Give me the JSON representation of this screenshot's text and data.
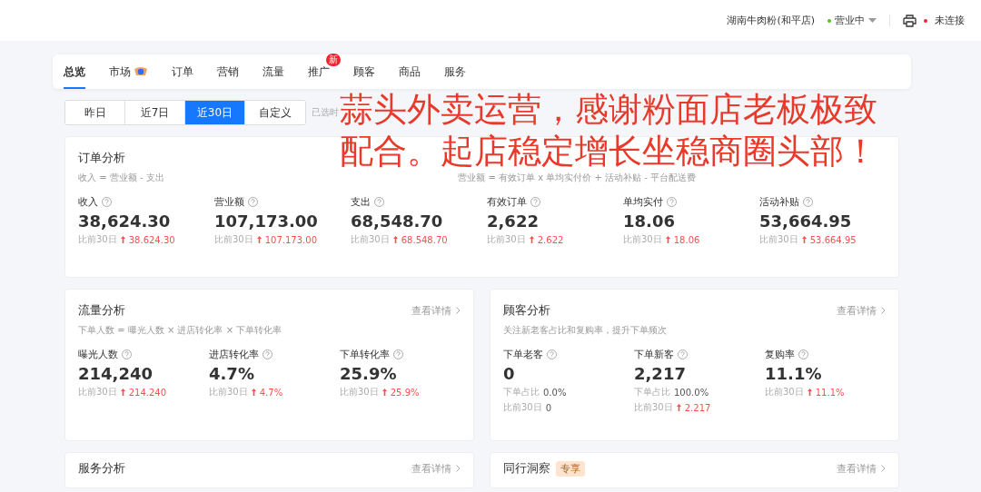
{
  "header": {
    "store": "湖南牛肉粉(和平店)",
    "status": "营业中",
    "printer": "未连接"
  },
  "tabs": [
    {
      "label": "总览",
      "selected": true
    },
    {
      "label": "市场",
      "selected": false,
      "icon": true
    },
    {
      "label": "订单",
      "selected": false
    },
    {
      "label": "营销",
      "selected": false
    },
    {
      "label": "流量",
      "selected": false
    },
    {
      "label": "推广",
      "selected": false,
      "badge": "新"
    },
    {
      "label": "顾客",
      "selected": false
    },
    {
      "label": "商品",
      "selected": false
    },
    {
      "label": "服务",
      "selected": false
    }
  ],
  "ranges": [
    {
      "label": "昨日",
      "selected": false
    },
    {
      "label": "近7日",
      "selected": false
    },
    {
      "label": "近30日",
      "selected": true
    },
    {
      "label": "自定义",
      "selected": false
    }
  ],
  "range_note": "已选时",
  "order_card": {
    "title": "订单分析",
    "formulas": [
      "收入 = 营业额 - 支出",
      "营业额 = 有效订单 x 单均实付价 + 活动补贴 - 平台配送费"
    ],
    "metrics": [
      {
        "label": "收入",
        "value": "38,624.30",
        "compare": "比前30日",
        "change": "38.624.30"
      },
      {
        "label": "营业额",
        "value": "107,173.00",
        "compare": "比前30日",
        "change": "107.173.00"
      },
      {
        "label": "支出",
        "value": "68,548.70",
        "compare": "比前30日",
        "change": "68.548.70"
      },
      {
        "label": "有效订单",
        "value": "2,622",
        "compare": "比前30日",
        "change": "2.622"
      },
      {
        "label": "单均实付",
        "value": "18.06",
        "compare": "比前30日",
        "change": "18.06"
      },
      {
        "label": "活动补贴",
        "value": "53,664.95",
        "compare": "比前30日",
        "change": "53.664.95"
      }
    ]
  },
  "cards": [
    {
      "title": "流量分析",
      "link": "查看详情",
      "formula": "下单人数 = 曝光人数 × 进店转化率 × 下单转化率",
      "metrics": [
        {
          "label": "曝光人数",
          "value": "214,240",
          "lines": [
            {
              "label": "比前30日",
              "value": "214.240",
              "up": true
            }
          ]
        },
        {
          "label": "进店转化率",
          "value": "4.7%",
          "lines": [
            {
              "label": "比前30日",
              "value": "4.7%",
              "up": true
            }
          ]
        },
        {
          "label": "下单转化率",
          "value": "25.9%",
          "lines": [
            {
              "label": "比前30日",
              "value": "25.9%",
              "up": true
            }
          ]
        }
      ]
    },
    {
      "title": "顾客分析",
      "link": "查看详情",
      "formula": "关注新老客占比和复购率，提升下单频次",
      "metrics": [
        {
          "label": "下单老客",
          "value": "0",
          "lines": [
            {
              "label": "下单占比",
              "value": "0.0%",
              "up": false
            },
            {
              "label": "比前30日",
              "value": "0",
              "up": false
            }
          ]
        },
        {
          "label": "下单新客",
          "value": "2,217",
          "lines": [
            {
              "label": "下单占比",
              "value": "100.0%",
              "up": false
            },
            {
              "label": "比前30日",
              "value": "2.217",
              "up": true
            }
          ]
        },
        {
          "label": "复购率",
          "value": "11.1%",
          "lines": [
            {
              "label": "比前30日",
              "value": "11.1%",
              "up": true
            }
          ]
        }
      ]
    }
  ],
  "more_cards": [
    {
      "title": "服务分析",
      "link": "查看详情"
    },
    {
      "title": "同行洞察",
      "link": "查看详情",
      "badge": "专享"
    }
  ],
  "overlay": "蒜头外卖运营，感谢粉面店老板极致配合。起店稳定增长坐稳商圈头部！"
}
